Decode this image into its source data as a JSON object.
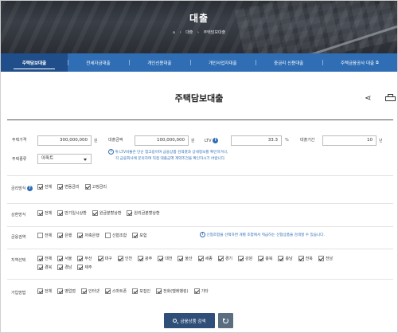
{
  "hero": {
    "title": "대출",
    "breadcrumb": [
      "⌂",
      "›",
      "대출",
      "›",
      "주택담보대출"
    ]
  },
  "tabs": [
    {
      "label": "주택담보대출",
      "active": true
    },
    {
      "label": "전세자금대출",
      "active": false
    },
    {
      "label": "개인신용대출",
      "active": false
    },
    {
      "label": "개인사업자대출",
      "active": false
    },
    {
      "label": "중금리 신용대출",
      "active": false
    },
    {
      "label": "주택금융공사 대출",
      "active": false,
      "external": true
    }
  ],
  "page_title": "주택담보대출",
  "form": {
    "house_price": {
      "label": "주택가격",
      "value": "300,000,000",
      "unit": "원"
    },
    "loan_amount": {
      "label": "대출금액",
      "value": "100,000,000",
      "unit": "원"
    },
    "ltv": {
      "label": "LTV",
      "value": "33.3",
      "unit": "%"
    },
    "loan_period": {
      "label": "대출기간",
      "value": "10",
      "unit": "년"
    },
    "house_type": {
      "label": "주택종류",
      "value": "아파트"
    },
    "ltv_note_1": "위 LTV비율은 단순 참고용이며 금융상품 검색결과 상세정보를 확인하거나,",
    "ltv_note_2": "각 금융회사에 문의하여 직접 대출금액 계약조건을 확인하시기 바랍니다."
  },
  "filters": {
    "rate_type": {
      "label": "금리방식",
      "options": [
        {
          "label": "전체",
          "checked": true
        },
        {
          "label": "변동금리",
          "checked": true
        },
        {
          "label": "고정금리",
          "checked": true
        }
      ]
    },
    "repay_type": {
      "label": "상환방식",
      "options": [
        {
          "label": "전체",
          "checked": true
        },
        {
          "label": "만기일시상환",
          "checked": true
        },
        {
          "label": "원금분할상환",
          "checked": true
        },
        {
          "label": "원리금분할상환",
          "checked": true
        }
      ]
    },
    "fin_sector": {
      "label": "금융권역",
      "options": [
        {
          "label": "전체",
          "checked": false
        },
        {
          "label": "은행",
          "checked": true
        },
        {
          "label": "저축은행",
          "checked": true
        },
        {
          "label": "신협조합",
          "checked": false
        },
        {
          "label": "보험",
          "checked": true
        }
      ],
      "note": "신협조합을 선택하면 개별 조합에서 취급하는 신협상품을 검색할 수 있습니다."
    },
    "region": {
      "label": "지역선택",
      "options_row1": [
        {
          "label": "전체",
          "checked": true
        },
        {
          "label": "서울",
          "checked": true
        },
        {
          "label": "부산",
          "checked": true
        },
        {
          "label": "대구",
          "checked": true
        },
        {
          "label": "인천",
          "checked": true
        },
        {
          "label": "광주",
          "checked": true
        },
        {
          "label": "대전",
          "checked": true
        },
        {
          "label": "울산",
          "checked": true
        },
        {
          "label": "세종",
          "checked": true
        },
        {
          "label": "경기",
          "checked": true
        },
        {
          "label": "강원",
          "checked": true
        },
        {
          "label": "충북",
          "checked": true
        },
        {
          "label": "충남",
          "checked": true
        },
        {
          "label": "전북",
          "checked": true
        },
        {
          "label": "전남",
          "checked": true
        }
      ],
      "options_row2": [
        {
          "label": "경북",
          "checked": true
        },
        {
          "label": "경남",
          "checked": true
        },
        {
          "label": "제주",
          "checked": true
        }
      ]
    },
    "join_method": {
      "label": "가입방법",
      "options": [
        {
          "label": "전체",
          "checked": true
        },
        {
          "label": "영업점",
          "checked": true
        },
        {
          "label": "인터넷",
          "checked": true
        },
        {
          "label": "스마트폰",
          "checked": true
        },
        {
          "label": "모집인",
          "checked": true
        },
        {
          "label": "전화(텔레뱅킹)",
          "checked": true
        },
        {
          "label": "기타",
          "checked": true
        }
      ]
    }
  },
  "buttons": {
    "search": "금융상품 검색"
  },
  "icons": {
    "share": "share-icon",
    "print": "print-icon",
    "info": "info-icon",
    "search": "search-icon",
    "reset": "reset-icon"
  },
  "colors": {
    "tab_bar": "#2f6db5",
    "tab_active": "#1f4e8a",
    "search_button": "#2f4f79",
    "reset_button": "#5b6e80",
    "note_text": "#2f6db5"
  }
}
